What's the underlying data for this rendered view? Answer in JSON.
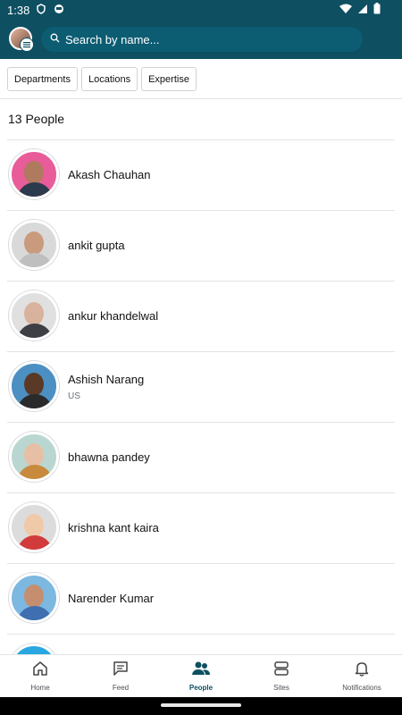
{
  "status_bar": {
    "time": "1:38"
  },
  "search": {
    "placeholder": "Search by name..."
  },
  "filters": [
    "Departments",
    "Locations",
    "Expertise"
  ],
  "people_count": "13 People",
  "people": [
    {
      "name": "Akash Chauhan",
      "sub": ""
    },
    {
      "name": "ankit gupta",
      "sub": ""
    },
    {
      "name": "ankur khandelwal",
      "sub": ""
    },
    {
      "name": "Ashish Narang",
      "sub": "US"
    },
    {
      "name": "bhawna pandey",
      "sub": ""
    },
    {
      "name": "krishna kant kaira",
      "sub": ""
    },
    {
      "name": "Narender Kumar",
      "sub": ""
    },
    {
      "name": "",
      "sub": ""
    }
  ],
  "nav": [
    {
      "label": "Home",
      "icon": "home-icon"
    },
    {
      "label": "Feed",
      "icon": "feed-icon"
    },
    {
      "label": "People",
      "icon": "people-icon",
      "active": true
    },
    {
      "label": "Sites",
      "icon": "sites-icon"
    },
    {
      "label": "Notifications",
      "icon": "bell-icon"
    }
  ],
  "colors": {
    "header": "#0e4f62",
    "accent": "#0e4f62"
  }
}
